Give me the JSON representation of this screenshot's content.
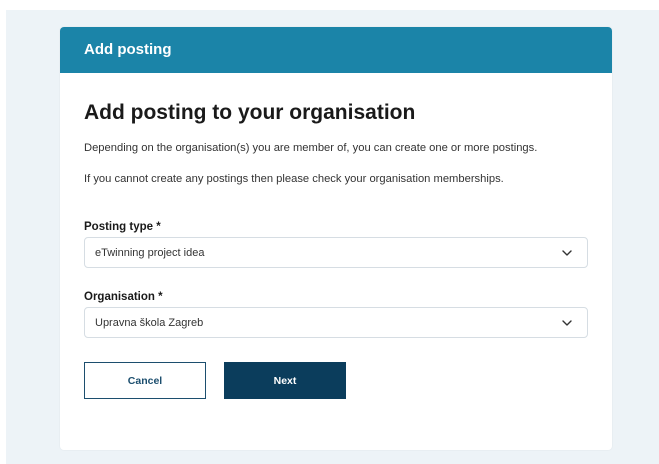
{
  "dialog": {
    "header_title": "Add posting",
    "title": "Add posting to your organisation",
    "description_1": "Depending on the organisation(s) you are member of, you can create one or more postings.",
    "description_2": "If you cannot create any postings then please check your organisation memberships."
  },
  "form": {
    "posting_type": {
      "label": "Posting type *",
      "value": "eTwinning project idea",
      "icon": "chevron-down-icon"
    },
    "organisation": {
      "label": "Organisation *",
      "value": "Upravna škola Zagreb",
      "icon": "chevron-down-icon"
    }
  },
  "actions": {
    "cancel_label": "Cancel",
    "next_label": "Next"
  },
  "colors": {
    "header_bg": "#1b84a8",
    "primary_button": "#0b3d5c",
    "page_bg": "#edf3f7"
  }
}
